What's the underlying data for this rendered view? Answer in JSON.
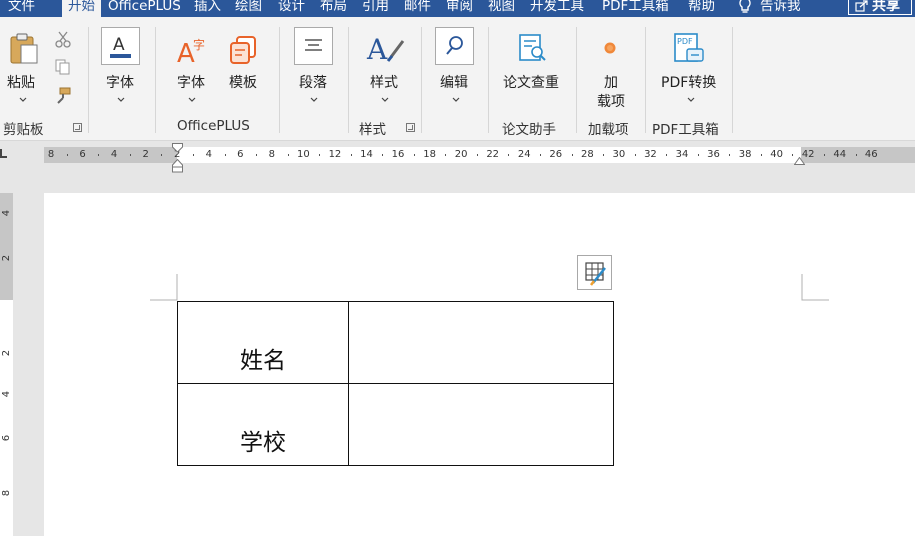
{
  "tabs": [
    {
      "label": "文件",
      "active": false
    },
    {
      "label": "开始",
      "active": true
    },
    {
      "label": "OfficePLUS",
      "active": false
    },
    {
      "label": "插入",
      "active": false
    },
    {
      "label": "绘图",
      "active": false
    },
    {
      "label": "设计",
      "active": false
    },
    {
      "label": "布局",
      "active": false
    },
    {
      "label": "引用",
      "active": false
    },
    {
      "label": "邮件",
      "active": false
    },
    {
      "label": "审阅",
      "active": false
    },
    {
      "label": "视图",
      "active": false
    },
    {
      "label": "开发工具",
      "active": false
    },
    {
      "label": "PDF工具箱",
      "active": false
    },
    {
      "label": "帮助",
      "active": false
    }
  ],
  "tell_me": "告诉我",
  "share": "共享",
  "ribbon": {
    "clipboard": {
      "paste": "粘贴",
      "group": "剪贴板"
    },
    "font": {
      "button": "字体"
    },
    "officeplus": {
      "font": "字体",
      "template": "模板",
      "group": "OfficePLUS"
    },
    "paragraph": {
      "button": "段落"
    },
    "styles": {
      "button": "样式",
      "group": "样式"
    },
    "editing": {
      "button": "编辑"
    },
    "thesis": {
      "button": "论文查重",
      "group": "论文助手"
    },
    "addins": {
      "button_line1": "加",
      "button_line2": "载项",
      "group": "加载项"
    },
    "pdf": {
      "button": "PDF转换",
      "group": "PDF工具箱"
    }
  },
  "ruler": {
    "labels": [
      "8",
      "6",
      "4",
      "2",
      "2",
      "4",
      "6",
      "8",
      "10",
      "12",
      "14",
      "16",
      "18",
      "20",
      "22",
      "24",
      "26",
      "28",
      "30",
      "32",
      "34",
      "36",
      "38",
      "40",
      "42",
      "44",
      "46"
    ],
    "vertical_labels": [
      "4",
      "2",
      "2",
      "4",
      "6",
      "8"
    ]
  },
  "table": {
    "rows": [
      [
        "姓名",
        ""
      ],
      [
        "学校",
        ""
      ]
    ]
  },
  "colors": {
    "accent": "#2b579a",
    "ribbon_bg": "#f3f3f3",
    "canvas_bg": "#e6e6e6"
  }
}
